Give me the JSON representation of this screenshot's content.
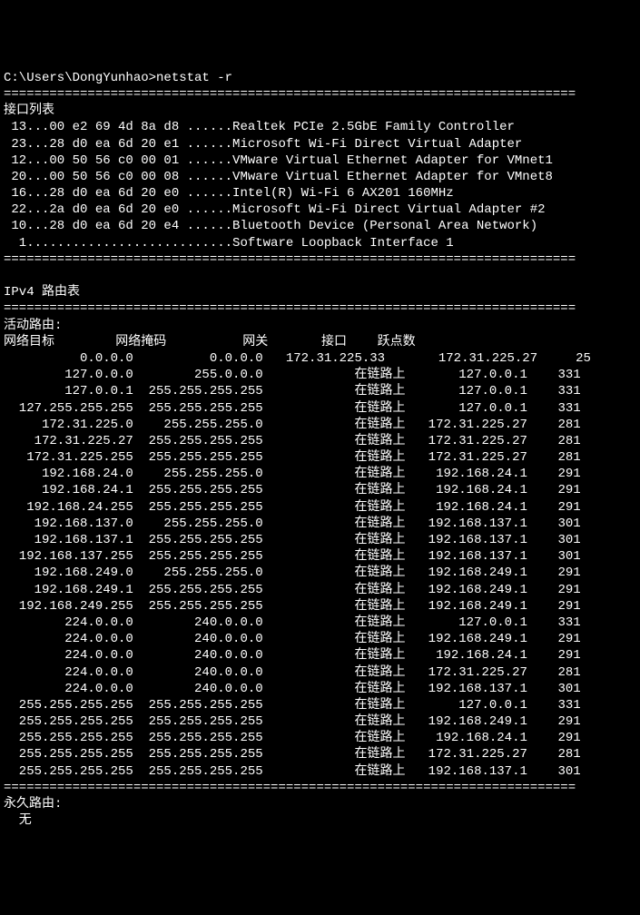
{
  "prompt": "C:\\Users\\DongYunhao>netstat -r",
  "sep": "===========================================================================",
  "interface_list_title": "接口列表",
  "interfaces": [
    " 13...00 e2 69 4d 8a d8 ......Realtek PCIe 2.5GbE Family Controller",
    " 23...28 d0 ea 6d 20 e1 ......Microsoft Wi-Fi Direct Virtual Adapter",
    " 12...00 50 56 c0 00 01 ......VMware Virtual Ethernet Adapter for VMnet1",
    " 20...00 50 56 c0 00 08 ......VMware Virtual Ethernet Adapter for VMnet8",
    " 16...28 d0 ea 6d 20 e0 ......Intel(R) Wi-Fi 6 AX201 160MHz",
    " 22...2a d0 ea 6d 20 e0 ......Microsoft Wi-Fi Direct Virtual Adapter #2",
    " 10...28 d0 ea 6d 20 e4 ......Bluetooth Device (Personal Area Network)",
    "  1...........................Software Loopback Interface 1"
  ],
  "ipv4_title": "IPv4 路由表",
  "active_routes_title": "活动路由:",
  "headers": {
    "dest": "网络目标",
    "mask": "网络掩码",
    "gateway": "网关",
    "iface": "接口",
    "metric": "跃点数"
  },
  "routes": [
    {
      "dest": "0.0.0.0",
      "mask": "0.0.0.0",
      "gw": "172.31.225.33",
      "iface": "172.31.225.27",
      "metric": "25"
    },
    {
      "dest": "127.0.0.0",
      "mask": "255.0.0.0",
      "gw": "在链路上",
      "iface": "127.0.0.1",
      "metric": "331"
    },
    {
      "dest": "127.0.0.1",
      "mask": "255.255.255.255",
      "gw": "在链路上",
      "iface": "127.0.0.1",
      "metric": "331"
    },
    {
      "dest": "127.255.255.255",
      "mask": "255.255.255.255",
      "gw": "在链路上",
      "iface": "127.0.0.1",
      "metric": "331"
    },
    {
      "dest": "172.31.225.0",
      "mask": "255.255.255.0",
      "gw": "在链路上",
      "iface": "172.31.225.27",
      "metric": "281"
    },
    {
      "dest": "172.31.225.27",
      "mask": "255.255.255.255",
      "gw": "在链路上",
      "iface": "172.31.225.27",
      "metric": "281"
    },
    {
      "dest": "172.31.225.255",
      "mask": "255.255.255.255",
      "gw": "在链路上",
      "iface": "172.31.225.27",
      "metric": "281"
    },
    {
      "dest": "192.168.24.0",
      "mask": "255.255.255.0",
      "gw": "在链路上",
      "iface": "192.168.24.1",
      "metric": "291"
    },
    {
      "dest": "192.168.24.1",
      "mask": "255.255.255.255",
      "gw": "在链路上",
      "iface": "192.168.24.1",
      "metric": "291"
    },
    {
      "dest": "192.168.24.255",
      "mask": "255.255.255.255",
      "gw": "在链路上",
      "iface": "192.168.24.1",
      "metric": "291"
    },
    {
      "dest": "192.168.137.0",
      "mask": "255.255.255.0",
      "gw": "在链路上",
      "iface": "192.168.137.1",
      "metric": "301"
    },
    {
      "dest": "192.168.137.1",
      "mask": "255.255.255.255",
      "gw": "在链路上",
      "iface": "192.168.137.1",
      "metric": "301"
    },
    {
      "dest": "192.168.137.255",
      "mask": "255.255.255.255",
      "gw": "在链路上",
      "iface": "192.168.137.1",
      "metric": "301"
    },
    {
      "dest": "192.168.249.0",
      "mask": "255.255.255.0",
      "gw": "在链路上",
      "iface": "192.168.249.1",
      "metric": "291"
    },
    {
      "dest": "192.168.249.1",
      "mask": "255.255.255.255",
      "gw": "在链路上",
      "iface": "192.168.249.1",
      "metric": "291"
    },
    {
      "dest": "192.168.249.255",
      "mask": "255.255.255.255",
      "gw": "在链路上",
      "iface": "192.168.249.1",
      "metric": "291"
    },
    {
      "dest": "224.0.0.0",
      "mask": "240.0.0.0",
      "gw": "在链路上",
      "iface": "127.0.0.1",
      "metric": "331"
    },
    {
      "dest": "224.0.0.0",
      "mask": "240.0.0.0",
      "gw": "在链路上",
      "iface": "192.168.249.1",
      "metric": "291"
    },
    {
      "dest": "224.0.0.0",
      "mask": "240.0.0.0",
      "gw": "在链路上",
      "iface": "192.168.24.1",
      "metric": "291"
    },
    {
      "dest": "224.0.0.0",
      "mask": "240.0.0.0",
      "gw": "在链路上",
      "iface": "172.31.225.27",
      "metric": "281"
    },
    {
      "dest": "224.0.0.0",
      "mask": "240.0.0.0",
      "gw": "在链路上",
      "iface": "192.168.137.1",
      "metric": "301"
    },
    {
      "dest": "255.255.255.255",
      "mask": "255.255.255.255",
      "gw": "在链路上",
      "iface": "127.0.0.1",
      "metric": "331"
    },
    {
      "dest": "255.255.255.255",
      "mask": "255.255.255.255",
      "gw": "在链路上",
      "iface": "192.168.249.1",
      "metric": "291"
    },
    {
      "dest": "255.255.255.255",
      "mask": "255.255.255.255",
      "gw": "在链路上",
      "iface": "192.168.24.1",
      "metric": "291"
    },
    {
      "dest": "255.255.255.255",
      "mask": "255.255.255.255",
      "gw": "在链路上",
      "iface": "172.31.225.27",
      "metric": "281"
    },
    {
      "dest": "255.255.255.255",
      "mask": "255.255.255.255",
      "gw": "在链路上",
      "iface": "192.168.137.1",
      "metric": "301"
    }
  ],
  "persistent_title": "永久路由:",
  "persistent_none": "  无"
}
